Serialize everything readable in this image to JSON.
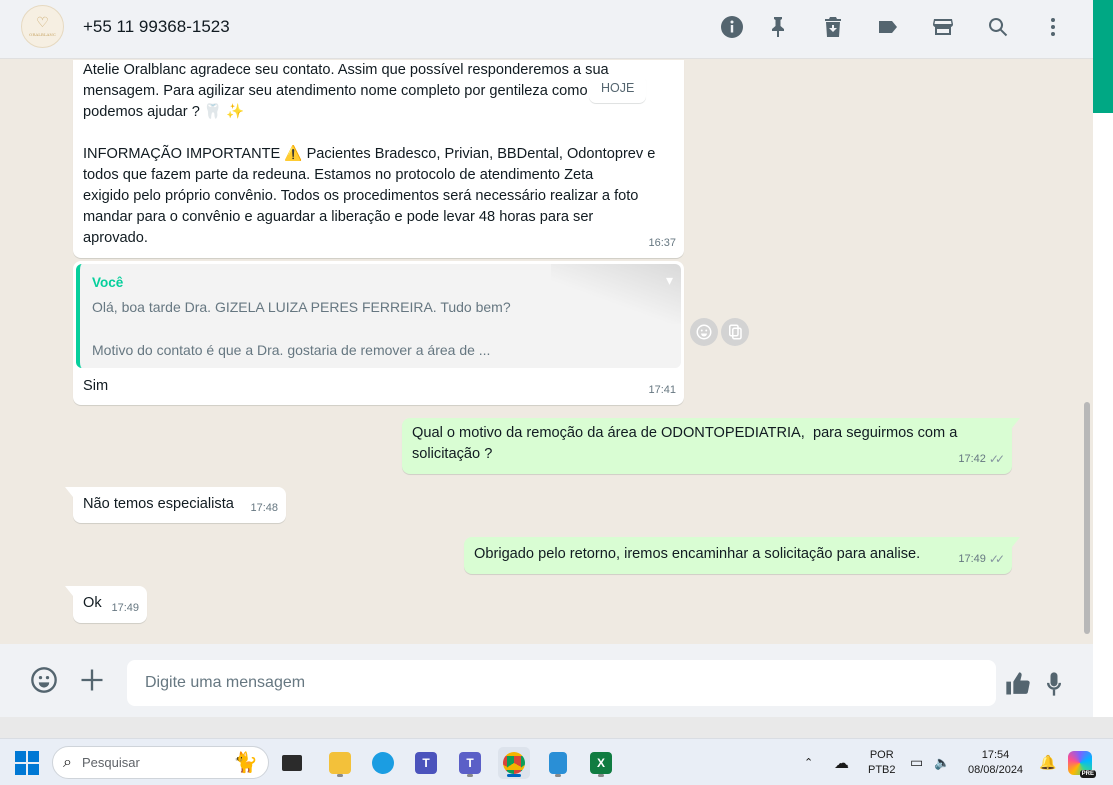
{
  "header": {
    "contact_name": "+55 11 99368-1523",
    "avatar_icon": "tooth-logo",
    "avatar_text": "ORALBLANC",
    "icons": [
      "info-icon",
      "pin-icon",
      "delete-icon",
      "label-icon",
      "store-icon",
      "search-icon",
      "menu-icon"
    ]
  },
  "chat": {
    "date_divider": "HOJE",
    "messages": [
      {
        "direction": "in",
        "text": "Atelie Oralblanc agradece seu contato. Assim que possível responderemos a sua\nmensagem. Para agilizar seu atendimento nome completo por gentileza como\npodemos ajudar ? 🦷 ✨\n\nINFORMAÇÃO IMPORTANTE ⚠️ Pacientes Bradesco, Privian, BBDental, Odontoprev e\ntodos que fazem parte da redeuna. Estamos no protocolo de atendimento Zeta\nexigido pelo próprio convênio. Todos os procedimentos será necessário realizar a foto\nmandar para o convênio e aguardar a liberação e pode levar 48 horas para ser\naprovado.",
        "time": "16:37"
      },
      {
        "direction": "in",
        "quote_author": "Você",
        "quote_line1": "Olá, boa tarde Dra. GIZELA LUIZA PERES FERREIRA. Tudo bem?",
        "quote_line2": "Motivo do contato é que a Dra. gostaria de remover a área de ...",
        "text": "Sim",
        "time": "17:41"
      },
      {
        "direction": "out",
        "text": "Qual o motivo da remoção da área de ODONTOPEDIATRIA,  para seguirmos com a\nsolicitação ?",
        "time": "17:42",
        "ticks": "✓✓"
      },
      {
        "direction": "in",
        "text": "Não temos especialista",
        "time": "17:48"
      },
      {
        "direction": "out",
        "text": "Obrigado pelo retorno, iremos encaminhar a solicitação para analise.",
        "time": "17:49",
        "ticks": "✓✓"
      },
      {
        "direction": "in",
        "text": "Ok",
        "time": "17:49"
      }
    ]
  },
  "composer": {
    "placeholder": "Digite uma mensagem"
  },
  "taskbar": {
    "search_label": "Pesquisar",
    "language": "POR",
    "layout": "PTB2",
    "time": "17:54",
    "date": "08/08/2024",
    "copilot_badge": "PRE"
  },
  "colors": {
    "accent": "#00a884",
    "outgoing_bubble": "#d9fdd3",
    "chat_background": "#efeae2",
    "quote_bar": "#06cf9c"
  }
}
